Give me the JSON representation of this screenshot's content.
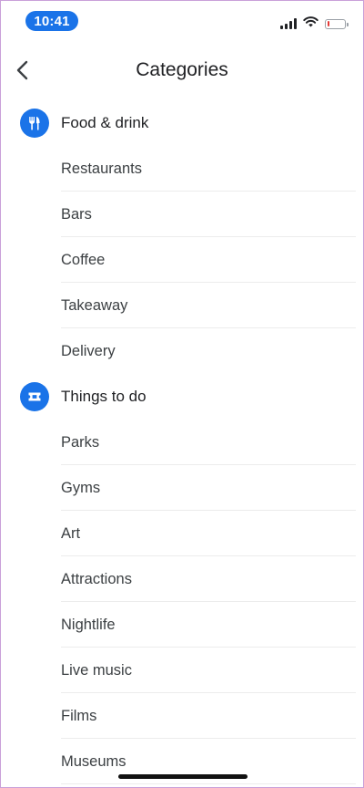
{
  "status_bar": {
    "time": "10:41"
  },
  "header": {
    "title": "Categories"
  },
  "sections": [
    {
      "title": "Food & drink",
      "icon": "fork-knife-icon",
      "items": [
        "Restaurants",
        "Bars",
        "Coffee",
        "Takeaway",
        "Delivery"
      ]
    },
    {
      "title": "Things to do",
      "icon": "ticket-icon",
      "items": [
        "Parks",
        "Gyms",
        "Art",
        "Attractions",
        "Nightlife",
        "Live music",
        "Films",
        "Museums"
      ]
    }
  ],
  "colors": {
    "accent": "#1a73e8",
    "battery_low": "#e53935"
  },
  "battery_level_fraction": 0.1
}
